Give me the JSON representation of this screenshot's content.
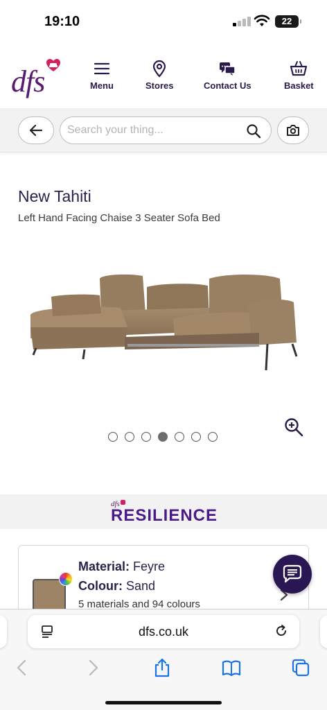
{
  "status_bar": {
    "time": "19:10",
    "battery": "22"
  },
  "header": {
    "logo_text": "dfs",
    "nav": [
      {
        "label": "Menu",
        "icon": "menu-icon"
      },
      {
        "label": "Stores",
        "icon": "location-pin-icon"
      },
      {
        "label": "Contact Us",
        "icon": "chat-bubbles-icon"
      },
      {
        "label": "Basket",
        "icon": "basket-icon"
      }
    ],
    "brand_color": "#5a1a6e",
    "heart_color": "#d3205f"
  },
  "search": {
    "placeholder": "Search your thing..."
  },
  "product": {
    "title": "New Tahiti",
    "subtitle": "Left Hand Facing Chaise 3 Seater Sofa Bed",
    "image_icon": "sofa-image",
    "carousel_dots": 7,
    "active_dot": 4
  },
  "resilience": {
    "mini_logo": "dfs",
    "word": "RESILIENCE"
  },
  "material_card": {
    "material_label": "Material:",
    "material_value": "Feyre",
    "colour_label": "Colour:",
    "colour_value": "Sand",
    "count_text": "5 materials and 94 colours",
    "swatch_color": "#9d8466"
  },
  "browser": {
    "url": "dfs.co.uk"
  }
}
